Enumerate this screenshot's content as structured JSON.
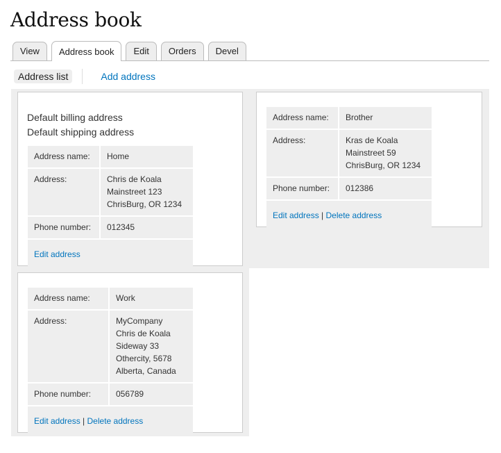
{
  "page": {
    "title": "Address book"
  },
  "tabs": [
    {
      "label": "View",
      "active": false
    },
    {
      "label": "Address book",
      "active": true
    },
    {
      "label": "Edit",
      "active": false
    },
    {
      "label": "Orders",
      "active": false
    },
    {
      "label": "Devel",
      "active": false
    }
  ],
  "subtabs": {
    "list": "Address list",
    "add": "Add address"
  },
  "labels": {
    "name": "Address name:",
    "address": "Address:",
    "phone": "Phone number:",
    "edit": "Edit address",
    "delete": "Delete address",
    "separator": "|"
  },
  "addresses": [
    {
      "defaults": [
        "Default billing address",
        "Default shipping address"
      ],
      "name": "Home",
      "lines": [
        "Chris de Koala",
        "Mainstreet 123",
        "ChrisBurg, OR 1234"
      ],
      "phone": "012345",
      "can_delete": false
    },
    {
      "defaults": [],
      "name": "Brother",
      "lines": [
        "Kras de Koala",
        "Mainstreet 59",
        "ChrisBurg, OR 1234"
      ],
      "phone": "012386",
      "can_delete": true
    },
    {
      "defaults": [],
      "name": "Work",
      "lines": [
        "MyCompany",
        "Chris de Koala",
        "Sideway 33",
        "Othercity, 5678",
        "Alberta, Canada"
      ],
      "phone": "056789",
      "can_delete": true
    }
  ],
  "colors": {
    "link": "#0074bd",
    "panel_bg": "#eeeeee",
    "border": "#cccccc"
  }
}
